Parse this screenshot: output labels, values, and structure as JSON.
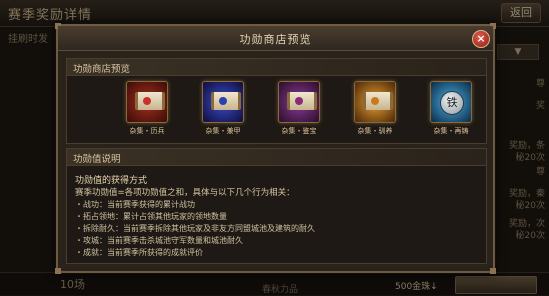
{
  "background": {
    "title": "赛季奖励详情",
    "back_label": "返回",
    "tab_text": "挂刷时发",
    "select_text": "",
    "side_texts": [
      "尊",
      "奖",
      "奖励，条",
      "秘20次",
      "尊",
      "奖励，秦",
      "秘20次",
      "奖励，次",
      "秘20次"
    ],
    "footer_left": "10场",
    "footer_mid": "春秋力品",
    "footer_right": "500金珠↓"
  },
  "modal": {
    "title": "功勋商店预览",
    "close_icon": "close-icon",
    "shop_section": {
      "title": "功勋商店预览",
      "items": [
        {
          "label": "杂集・历兵",
          "icon": "scroll-icon",
          "color": "#c8322a"
        },
        {
          "label": "杂集・兼甲",
          "icon": "scroll-icon",
          "color": "#2b3fb0"
        },
        {
          "label": "杂集・鉴宝",
          "icon": "scroll-icon",
          "color": "#8a2b7a"
        },
        {
          "label": "杂集・驯养",
          "icon": "scroll-icon",
          "color": "#c87a1e"
        },
        {
          "label": "杂集・再铸",
          "icon": "coin-icon",
          "color": "#2e8fc8",
          "glyph": "铁"
        }
      ]
    },
    "merit_section": {
      "title": "功勋值说明",
      "heading": "功勋值的获得方式",
      "intro": "赛季功勋值=各项功勋值之和，具体与以下几个行为相关：",
      "lines": [
        "・战功：当前赛季获得的累计战功",
        "・拓占领地：累计占领其他玩家的领地数量",
        "・拆除耐久：当前赛季拆除其他玩家及非友方同盟城池及建筑的耐久",
        "・攻城：当前赛季击杀城池守军数量和城池耐久",
        "・成就：当前赛季所获得的成就评价"
      ]
    }
  }
}
